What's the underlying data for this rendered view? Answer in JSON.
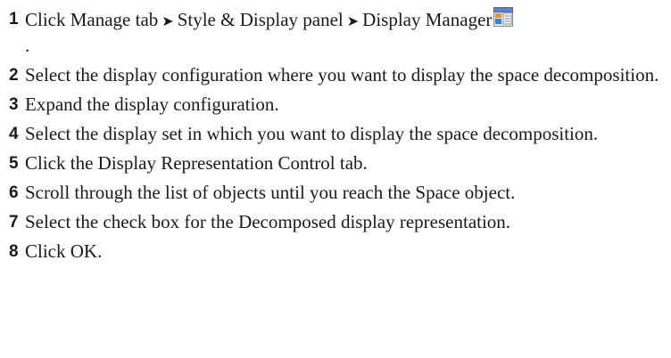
{
  "steps": [
    {
      "num": "1",
      "part1": "Click Manage tab",
      "part2": "Style & Display panel",
      "part3": "Display Manager",
      "separator": "➤",
      "icon": "display-manager-icon",
      "trailing": "."
    },
    {
      "num": "2",
      "text": "Select the display configuration where you want to display the space decomposition."
    },
    {
      "num": "3",
      "text": "Expand the display configuration."
    },
    {
      "num": "4",
      "text": "Select the display set in which you want to display the space decomposition."
    },
    {
      "num": "5",
      "text": "Click the Display Representation Control tab."
    },
    {
      "num": "6",
      "text": "Scroll through the list of objects until you reach the Space object."
    },
    {
      "num": "7",
      "text": "Select the check box for the Decomposed display representation."
    },
    {
      "num": "8",
      "text": "Click OK."
    }
  ]
}
